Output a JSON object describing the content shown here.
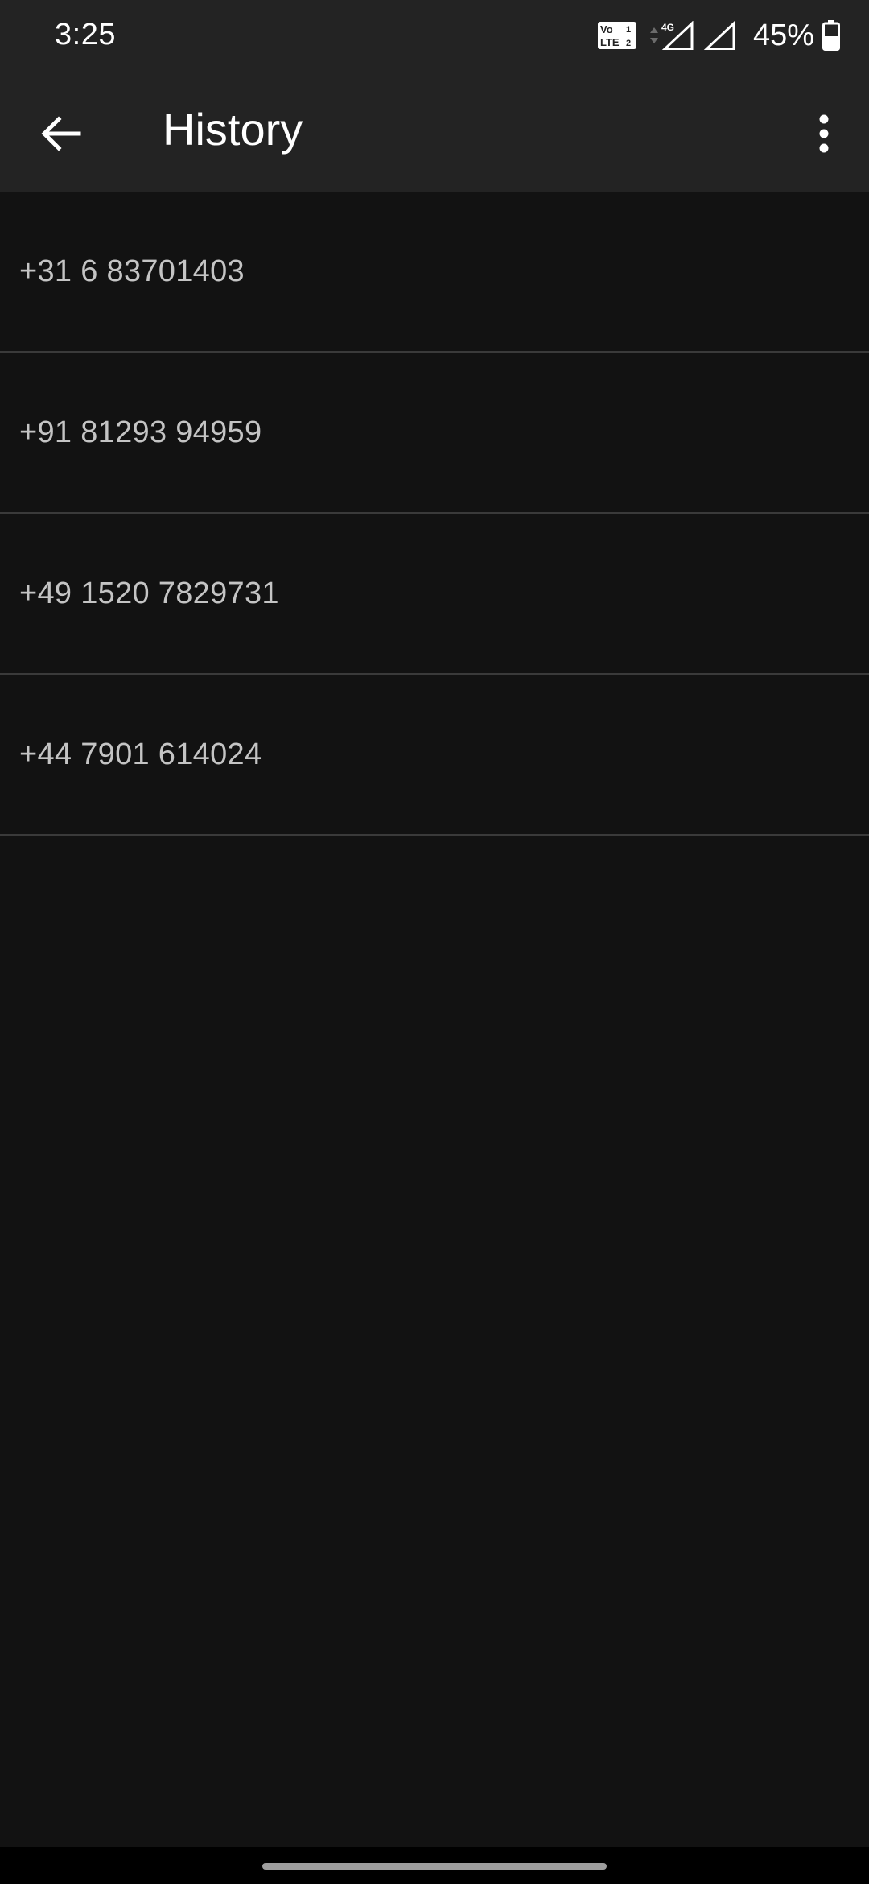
{
  "status_bar": {
    "time": "3:25",
    "battery_percent": "45%",
    "network_type": "4G",
    "volte_label_top": "Vo",
    "volte_label_bottom": "LTE",
    "volte_sim1": "1",
    "volte_sim2": "2",
    "icons": [
      "volte-icon",
      "data-arrows-icon",
      "signal-icon",
      "signal-icon",
      "battery-icon"
    ]
  },
  "app_bar": {
    "title": "History",
    "back_icon": "arrow-left-icon",
    "menu_icon": "more-vert-icon"
  },
  "history": {
    "items": [
      {
        "number": "+31 6 83701403"
      },
      {
        "number": "+91 81293 94959"
      },
      {
        "number": "+49 1520 7829731"
      },
      {
        "number": "+44 7901 614024"
      }
    ]
  },
  "colors": {
    "background": "#121212",
    "bar": "#232323",
    "divider": "#3a3a3a",
    "text_primary": "#ffffff",
    "text_secondary": "#c4c4c4"
  }
}
